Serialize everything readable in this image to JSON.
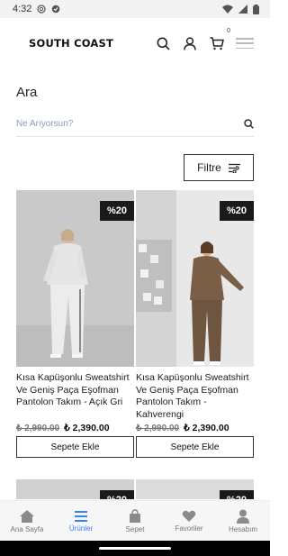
{
  "status_bar": {
    "time": "4:32"
  },
  "header": {
    "logo": "SOUTH COAST",
    "cart_count": "0"
  },
  "page": {
    "title": "Ara"
  },
  "search": {
    "placeholder": "Ne Arıyorsun?"
  },
  "filter": {
    "label": "Filtre"
  },
  "products": [
    {
      "name": "Kısa Kapüşonlu Sweatshirt Ve Geniş Paça Eşofman Pantolon Takım - Açık Gri",
      "old_price": "₺ 2,990.00",
      "new_price": "₺ 2,390.00",
      "discount": "%20",
      "button": "Sepete Ekle",
      "outfit_color": "#e4e4e4"
    },
    {
      "name": "Kısa Kapüşonlu Sweatshirt Ve Geniş Paça Eşofman Pantolon Takım - Kahverengi",
      "old_price": "₺ 2,990.00",
      "new_price": "₺ 2,390.00",
      "discount": "%20",
      "button": "Sepete Ekle",
      "outfit_color": "#7a5f46"
    }
  ],
  "next_row": [
    {
      "discount": "%20"
    },
    {
      "discount": "%20"
    }
  ],
  "bottom_nav": [
    {
      "label": "Ana Sayfa",
      "icon": "home-icon"
    },
    {
      "label": "Ürünler",
      "icon": "list-icon",
      "active": true
    },
    {
      "label": "Sepet",
      "icon": "bag-icon"
    },
    {
      "label": "Favoriler",
      "icon": "heart-icon"
    },
    {
      "label": "Hesabım",
      "icon": "user-icon"
    }
  ],
  "colors": {
    "accent": "#3b82f6",
    "badge": "#1a1a1a"
  }
}
